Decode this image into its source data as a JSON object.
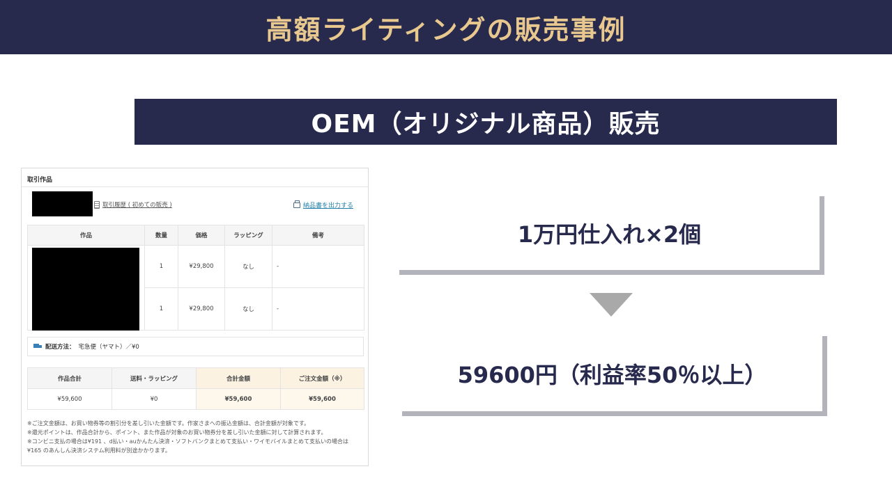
{
  "header": {
    "title": "高額ライティングの販売事例"
  },
  "subheader": {
    "title": "OEM（オリジナル商品）販売"
  },
  "panel": {
    "title": "取引作品",
    "history_link": "取引履歴 ( 初めての販売 )",
    "print_link": "納品書を出力する",
    "table": {
      "headers": [
        "作品",
        "数量",
        "価格",
        "ラッピング",
        "備考"
      ],
      "rows": [
        {
          "qty": "1",
          "price": "¥29,800",
          "wrap": "なし",
          "note": "-"
        },
        {
          "qty": "1",
          "price": "¥29,800",
          "wrap": "なし",
          "note": "-"
        }
      ]
    },
    "shipping": {
      "label": "配送方法：",
      "value": "宅急便（ヤマト）／¥0"
    },
    "totals": {
      "headers": [
        "作品合計",
        "送料・ラッピング",
        "合計金額",
        "ご注文金額（※）"
      ],
      "values": [
        "¥59,600",
        "¥0",
        "¥59,600",
        "¥59,600"
      ]
    },
    "notes": [
      "※ご注文金額は、お買い物券等の割引分を差し引いた金額です。作家さまへの振込金額は、合計金額が対象です。",
      "※還元ポイントは、作品合計から、ポイント、また作品が対象のお買い物券分を差し引いた金額に対して計算されます。",
      "※コンビニ支払の場合は¥191 、d払い・auかんたん決済・ソフトバンクまとめて支払い・ワイモバイルまとめて支払いの場合は",
      "¥165 のあんしん決済システム利用料が別途かかります。"
    ]
  },
  "boxes": {
    "top": "1万円仕入れ×2個",
    "bottom": "59600円（利益率50％以上）"
  },
  "colors": {
    "navy": "#272a4d",
    "gold": "#e8c88e",
    "gray_border": "#b3b3bb"
  }
}
